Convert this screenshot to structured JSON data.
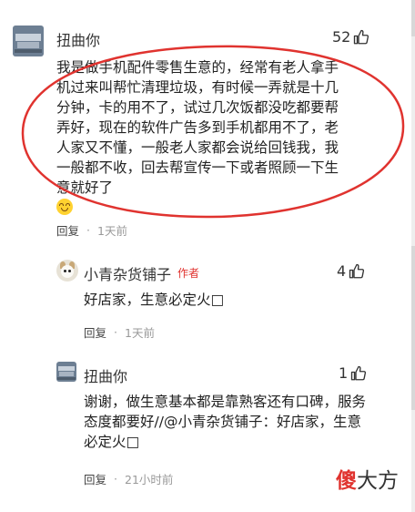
{
  "comments": [
    {
      "username": "扭曲你",
      "likes": "52",
      "text": "我是做手机配件零售生意的，经常有老人拿手机过来叫帮忙清理垃圾，有时候一弄就是十几分钟，卡的用不了，试过几次饭都没吃都要帮弄好，现在的软件广告多到手机都用不了，老人家又不懂，一般老人家都会说给回钱我，我一般都不收，回去帮宣传一下或者照顾一下生意就好了",
      "reply_label": "回复",
      "time": "1天前"
    },
    {
      "username": "小青杂货铺子",
      "author_tag": "作者",
      "likes": "4",
      "text": "好店家，生意必定火□",
      "reply_label": "回复",
      "time": "1天前"
    },
    {
      "username": "扭曲你",
      "likes": "1",
      "text": "谢谢，做生意基本都是靠熟客还有口碑，服务态度都要好//@小青杂货铺子：好店家，生意必定火□",
      "reply_label": "回复",
      "time": "21小时前"
    }
  ],
  "watermark": {
    "first": "傻",
    "rest": "大方"
  },
  "colors": {
    "highlight": "#e0332f",
    "text": "#222222",
    "muted": "#999999"
  },
  "icons": [
    "thumbs-up-icon",
    "smile-emoji"
  ]
}
